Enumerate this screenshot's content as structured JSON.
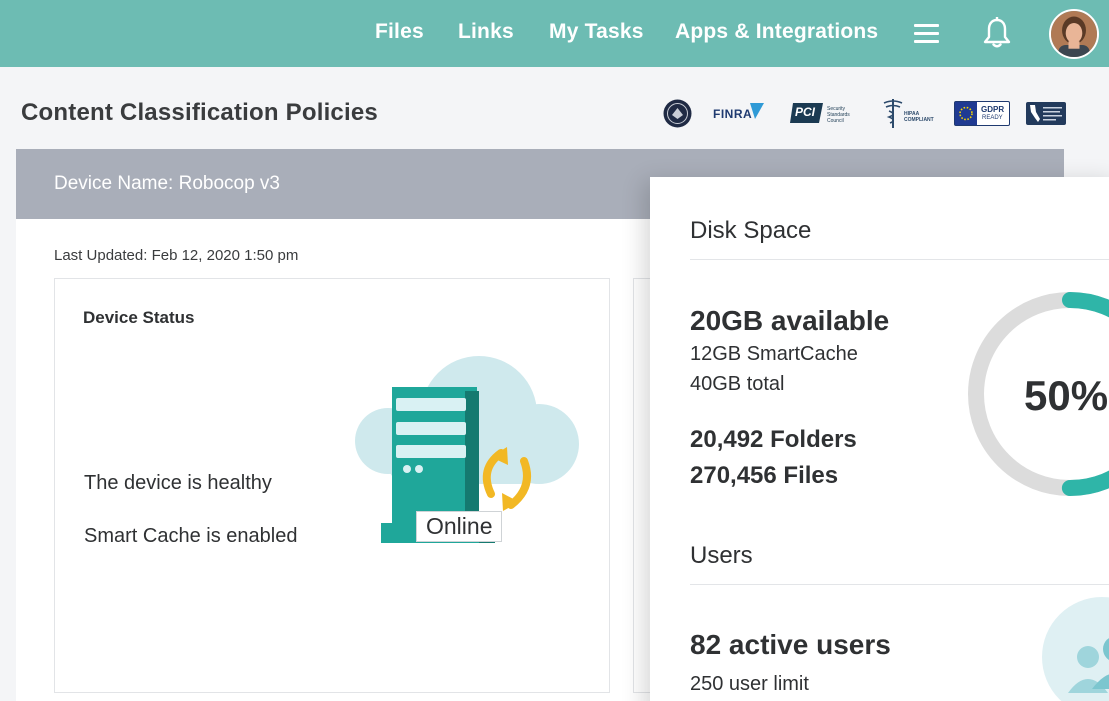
{
  "nav": {
    "items": [
      "Files",
      "Links",
      "My Tasks",
      "Apps & Integrations"
    ],
    "menu_icon": "hamburger-menu-icon",
    "notification_icon": "bell-icon",
    "avatar_icon": "user-avatar"
  },
  "page": {
    "title": "Content Classification Policies"
  },
  "badges": {
    "finra": "FINRA",
    "pci": "PCI",
    "pci_sub": "Security Standards Council",
    "hipaa": "HIPAA COMPLIANT",
    "gdpr": "GDPR",
    "gdpr_sub": "READY"
  },
  "device": {
    "name_label": "Device Name: Robocop v3",
    "last_updated": "Last Updated: Feb 12, 2020 1:50 pm",
    "status_title": "Device Status",
    "healthy": "The device is healthy",
    "smart_cache": "Smart Cache is enabled",
    "online": "Online"
  },
  "disk": {
    "title": "Disk Space",
    "available": "20GB available",
    "smartcache": "12GB SmartCache",
    "total": "40GB total",
    "folders": "20,492 Folders",
    "files": "270,456 Files",
    "percent_label": "50%",
    "percent": 50,
    "ring_color": "#2fb5a8",
    "ring_bg": "#dcdcdc"
  },
  "users": {
    "title": "Users",
    "active": "82 active users",
    "limit": "250 user limit"
  },
  "colors": {
    "nav_bg": "#6dbcb3",
    "device_header_bg": "#a9aeb9",
    "accent_teal": "#2fb5a8",
    "accent_yellow": "#f2b824"
  }
}
